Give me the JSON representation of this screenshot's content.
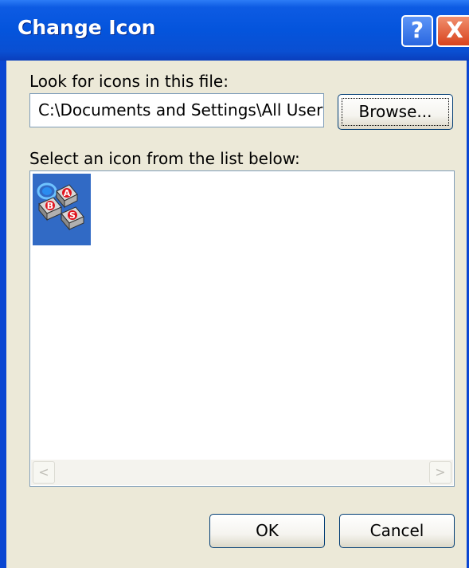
{
  "window": {
    "title": "Change Icon",
    "help_label": "?",
    "close_label": "X"
  },
  "file_section": {
    "label": "Look for icons in this file:",
    "path_value": "C:\\Documents and Settings\\All Users",
    "browse_label": "Browse..."
  },
  "icon_list": {
    "label": "Select an icon from the list below:",
    "icons": [
      {
        "name": "abc-blocks-icon",
        "selected": true,
        "letters": [
          "A",
          "B",
          "S"
        ]
      }
    ],
    "scroll_left": "<",
    "scroll_right": ">"
  },
  "footer": {
    "ok_label": "OK",
    "cancel_label": "Cancel"
  },
  "colors": {
    "titlebar": "#0454dc",
    "selection": "#316ac5",
    "dialog_bg": "#ece9d8",
    "close": "#d8431d"
  }
}
